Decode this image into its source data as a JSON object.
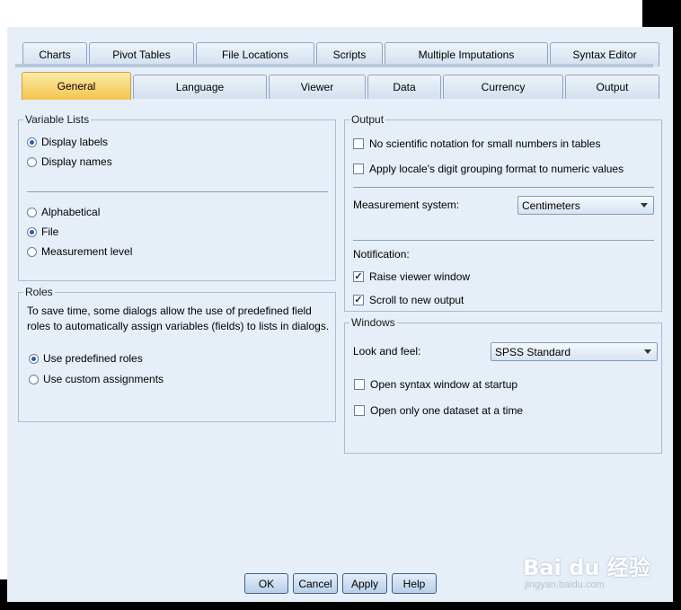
{
  "tabs_row1": [
    "Charts",
    "Pivot Tables",
    "File Locations",
    "Scripts",
    "Multiple Imputations",
    "Syntax Editor"
  ],
  "tabs_row2": [
    "General",
    "Language",
    "Viewer",
    "Data",
    "Currency",
    "Output"
  ],
  "variable_lists": {
    "legend": "Variable Lists",
    "display_labels": "Display labels",
    "display_names": "Display names",
    "alphabetical": "Alphabetical",
    "file": "File",
    "measurement_level": "Measurement level",
    "selected_display": "Display labels",
    "selected_order": "File"
  },
  "roles": {
    "legend": "Roles",
    "description": "To save time, some dialogs allow the use of predefined field roles to automatically assign variables (fields) to lists in dialogs.",
    "use_predefined": "Use predefined roles",
    "use_custom": "Use custom assignments",
    "selected": "Use predefined roles"
  },
  "output": {
    "legend": "Output",
    "no_scientific": "No scientific notation for small numbers in tables",
    "apply_locale": "Apply locale's digit  grouping format to numeric values",
    "measurement_label": "Measurement system:",
    "measurement_value": "Centimeters",
    "notification_label": "Notification:",
    "raise_viewer": "Raise viewer window",
    "scroll_to_new": "Scroll to new output",
    "no_scientific_checked": false,
    "apply_locale_checked": false,
    "raise_viewer_checked": true,
    "scroll_to_new_checked": true
  },
  "windows": {
    "legend": "Windows",
    "look_feel_label": "Look and feel:",
    "look_feel_value": "SPSS Standard",
    "open_syntax": "Open syntax window at startup",
    "open_one_dataset": "Open only one dataset at a time",
    "open_syntax_checked": false,
    "open_one_dataset_checked": false
  },
  "buttons": {
    "ok": "OK",
    "cancel": "Cancel",
    "apply": "Apply",
    "help": "Help"
  },
  "watermark": {
    "logo_text": "Bai du 经验",
    "url": "jingyan.baidu.com"
  },
  "colors": {
    "dialog_bg": "#e6eef7",
    "active_tab": "#f3c54e",
    "border": "#a9bcd2"
  }
}
